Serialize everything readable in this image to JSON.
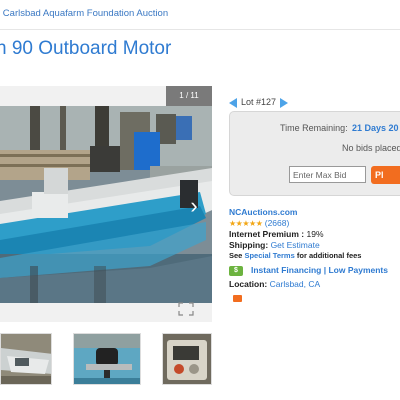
{
  "breadcrumb": {
    "text": "r Carlsbad Aquafarm Foundation Auction"
  },
  "page_title": "n 90 Outboard Motor",
  "gallery": {
    "counter": "1 / 11"
  },
  "lot": {
    "label": "Lot #127"
  },
  "bid_panel": {
    "time_label": "Time Remaining:",
    "time_value": "21 Days 20",
    "no_bids": "No bids placed",
    "max_bid_placeholder": "Enter Max Bid",
    "bid_button": "Pl"
  },
  "seller": {
    "name": "NCAuctions.com",
    "stars": "★★★★★",
    "rating_count": "(2668)",
    "premium_label": "Internet Premium :",
    "premium_value": "19%",
    "shipping_label": "Shipping:",
    "shipping_value": "Get Estimate",
    "fees_prefix": "See",
    "fees_link": "Special Terms",
    "fees_suffix": "for additional fees",
    "financing_icon": "$",
    "financing_text": "Instant Financing | Low Payments",
    "location_label": "Location:",
    "location_value": "Carlsbad, CA"
  },
  "colors": {
    "accent": "#2f7bd1",
    "bid_button": "#f26d1f",
    "financing": "#6cb33f",
    "panel": "#ececec"
  }
}
